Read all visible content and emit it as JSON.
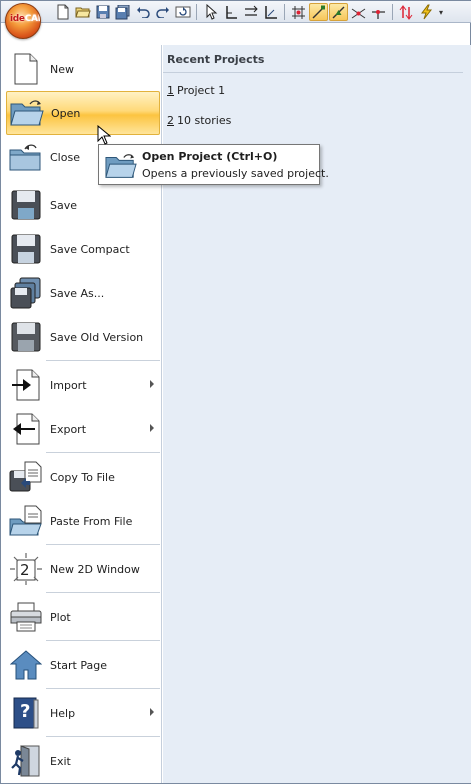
{
  "app": {
    "logo_prefix": "ide",
    "logo_text": "CAD"
  },
  "toolbar": {
    "icons": [
      "new-icon",
      "open-icon",
      "save-icon",
      "save-all-icon",
      "undo-icon",
      "redo-icon",
      "refresh-icon",
      "select-icon",
      "ortho-icon",
      "track-icon",
      "axis-icon",
      "grid-snap-icon",
      "end-snap-icon",
      "mid-snap-icon",
      "cross-snap-icon",
      "perp-snap-icon",
      "lightning-icon"
    ],
    "active": [
      "end-snap-icon",
      "mid-snap-icon"
    ],
    "dropdown_glyph": "▾"
  },
  "menu": {
    "items": [
      {
        "label": "New",
        "icon": "new-file-icon"
      },
      {
        "label": "Open",
        "icon": "open-folder-icon"
      },
      {
        "label": "Close",
        "icon": "close-folder-icon"
      },
      {
        "label": "Save",
        "icon": "save-disk-icon"
      },
      {
        "label": "Save Compact",
        "icon": "save-compact-icon"
      },
      {
        "label": "Save As...",
        "icon": "save-as-icon"
      },
      {
        "label": "Save Old Version",
        "icon": "save-old-icon"
      },
      {
        "label": "Import",
        "icon": "import-icon"
      },
      {
        "label": "Export",
        "icon": "export-icon"
      },
      {
        "label": "Copy To File",
        "icon": "copy-to-file-icon"
      },
      {
        "label": "Paste From File",
        "icon": "paste-from-file-icon"
      },
      {
        "label": "New 2D Window",
        "icon": "new-2d-window-icon",
        "icon_text": "2"
      },
      {
        "label": "Plot",
        "icon": "printer-icon"
      },
      {
        "label": "Start Page",
        "icon": "home-icon"
      },
      {
        "label": "Help",
        "icon": "help-book-icon",
        "icon_text": "?"
      },
      {
        "label": "Exit",
        "icon": "exit-door-icon"
      }
    ],
    "highlighted": "Open"
  },
  "recent": {
    "title": "Recent Projects",
    "items": [
      {
        "num": "1",
        "name": "Project 1"
      },
      {
        "num": "2",
        "name": "10 stories"
      }
    ]
  },
  "tooltip": {
    "title": "Open Project (Ctrl+O)",
    "description": "Opens a previously saved project."
  },
  "colors": {
    "highlight": "#fcc440",
    "panel_bg": "#e6edf6",
    "accent": "#2b6cb0"
  }
}
